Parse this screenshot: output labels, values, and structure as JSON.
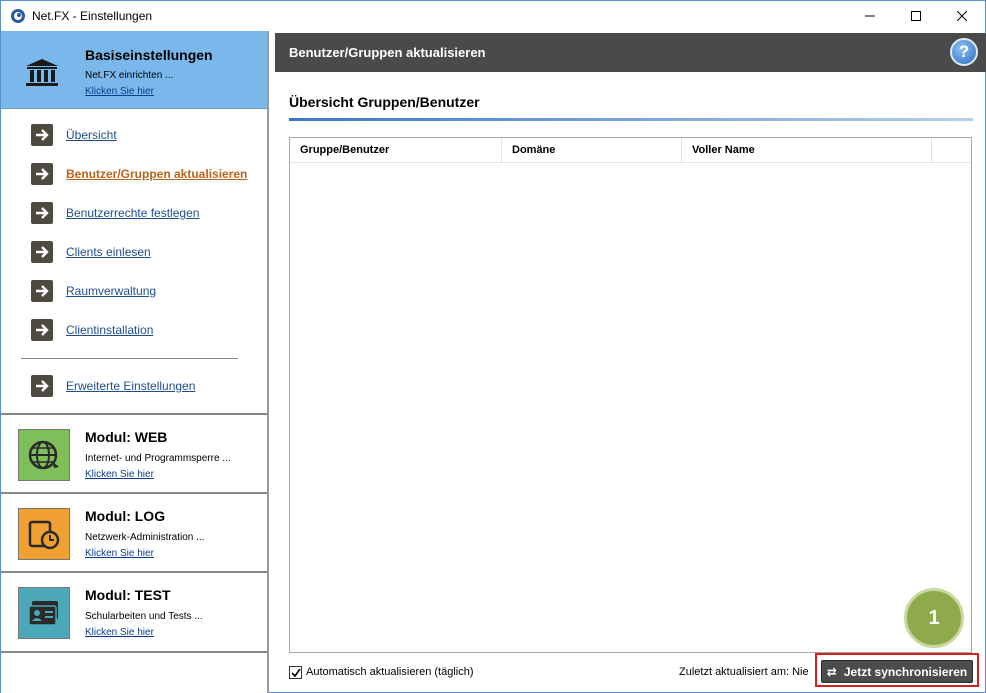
{
  "window": {
    "title": "Net.FX - Einstellungen"
  },
  "sidebar": {
    "basis": {
      "title": "Basiseinstellungen",
      "subtitle": "Net.FX einrichten ...",
      "link": "Klicken Sie hier",
      "icon": "bank-icon"
    },
    "nav": [
      {
        "label": "Übersicht",
        "active": false
      },
      {
        "label": "Benutzer/Gruppen aktualisieren",
        "active": true
      },
      {
        "label": "Benutzerrechte festlegen",
        "active": false
      },
      {
        "label": "Clients einlesen",
        "active": false
      },
      {
        "label": "Raumverwaltung",
        "active": false
      },
      {
        "label": "Clientinstallation",
        "active": false
      },
      {
        "label": "Erweiterte Einstellungen",
        "active": false
      }
    ],
    "modules": [
      {
        "title": "Modul: WEB",
        "subtitle": "Internet- und Programmsperre ...",
        "link": "Klicken Sie hier",
        "icon": "globe-icon",
        "color": "#7fbf5a"
      },
      {
        "title": "Modul: LOG",
        "subtitle": "Netzwerk-Administration ...",
        "link": "Klicken Sie hier",
        "icon": "folder-clock-icon",
        "color": "#f0a030"
      },
      {
        "title": "Modul: TEST",
        "subtitle": "Schularbeiten und Tests ...",
        "link": "Klicken Sie hier",
        "icon": "id-card-icon",
        "color": "#4aa8b8"
      }
    ]
  },
  "main": {
    "header": "Benutzer/Gruppen aktualisieren",
    "section_title": "Übersicht Gruppen/Benutzer",
    "columns": [
      "Gruppe/Benutzer",
      "Domäne",
      "Voller Name"
    ],
    "rows": [],
    "auto_update_label": "Automatisch aktualisieren (täglich)",
    "auto_update_checked": true,
    "last_updated": "Zuletzt aktualisiert am: Nie",
    "sync_label": "Jetzt synchronisieren",
    "marker": "1"
  },
  "colors": {
    "accent": "#7ab8ec",
    "active_nav": "#b8641c",
    "highlight": "#d21f1f",
    "marker": "#8faa4a"
  }
}
